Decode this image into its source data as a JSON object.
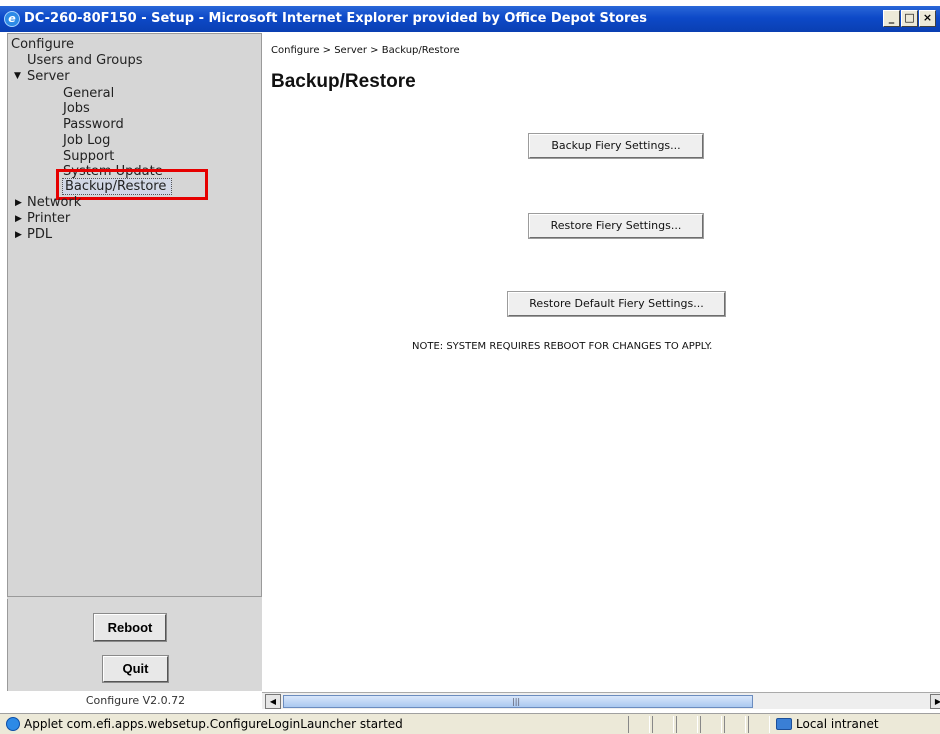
{
  "window": {
    "title": "DC-260-80F150 - Setup - Microsoft Internet Explorer provided by Office Depot Stores",
    "min_glyph": "_",
    "max_glyph": "□",
    "close_glyph": "×"
  },
  "sidebar": {
    "tree": {
      "root": "Configure",
      "users_and_groups": "Users and Groups",
      "server": "Server",
      "server_children": [
        "General",
        "Jobs",
        "Password",
        "Job Log",
        "Support",
        "System Update",
        "Backup/Restore"
      ],
      "network": "Network",
      "printer": "Printer",
      "pdl": "PDL"
    },
    "reboot_label": "Reboot",
    "quit_label": "Quit",
    "version": "Configure V2.0.72"
  },
  "main": {
    "breadcrumb": "Configure > Server > Backup/Restore",
    "title": "Backup/Restore",
    "backup_button": "Backup Fiery Settings...",
    "restore_button": "Restore Fiery Settings...",
    "restore_default_button": "Restore Default Fiery Settings...",
    "note": "NOTE: SYSTEM REQUIRES REBOOT FOR CHANGES TO APPLY."
  },
  "statusbar": {
    "message": "Applet com.efi.apps.websetup.ConfigureLoginLauncher started",
    "zone": "Local intranet"
  },
  "colors": {
    "titlebar": "#0d49c8",
    "highlight": "#e60000",
    "sidebar_bg": "#d6d6d6"
  }
}
